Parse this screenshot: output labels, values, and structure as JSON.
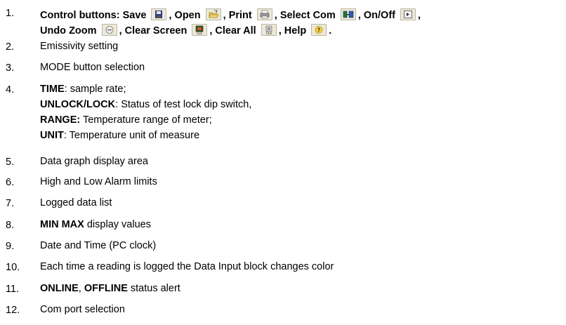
{
  "items": [
    {
      "num": "1.",
      "line1": {
        "label1": "Control buttons: Save",
        "label2": ", Open",
        "label3": ", Print",
        "label4": ", Select Com",
        "label5": ", On/Off",
        "end": ","
      },
      "line2": {
        "label1": "Undo Zoom",
        "label2": ", Clear Screen",
        "label3": ", Clear All",
        "label4": ", Help",
        "end": "."
      },
      "icons": [
        "save-icon",
        "open-icon",
        "print-icon",
        "select-com-icon",
        "on-off-icon",
        "undo-zoom-icon",
        "clear-screen-icon",
        "clear-all-icon",
        "help-icon"
      ]
    },
    {
      "num": "2.",
      "text": "Emissivity setting"
    },
    {
      "num": "3.",
      "text": "MODE button selection"
    },
    {
      "num": "4.",
      "l1_bold": "TIME",
      "l1_rest": ": sample rate;",
      "l2_bold": "UNLOCK/LOCK",
      "l2_rest": ": Status of test lock dip switch,",
      "l3_bold": "RANGE:",
      "l3_rest": " Temperature range of meter;",
      "l4_bold": "UNIT",
      "l4_rest": ": Temperature unit of measure"
    },
    {
      "num": "5.",
      "text": "Data graph display area"
    },
    {
      "num": "6.",
      "text": "High and Low Alarm limits"
    },
    {
      "num": "7.",
      "text": "Logged data list"
    },
    {
      "num": "8.",
      "bold": "MIN MAX",
      "rest": " display values"
    },
    {
      "num": "9.",
      "text": "Date and Time (PC clock)"
    },
    {
      "num": "10.",
      "text": "Each time a reading is logged the Data Input block changes color"
    },
    {
      "num": "11.",
      "bold1": "ONLINE",
      "mid": ", ",
      "bold2": "OFFLINE",
      "rest": " status alert"
    },
    {
      "num": "12.",
      "text": "Com port selection"
    }
  ]
}
